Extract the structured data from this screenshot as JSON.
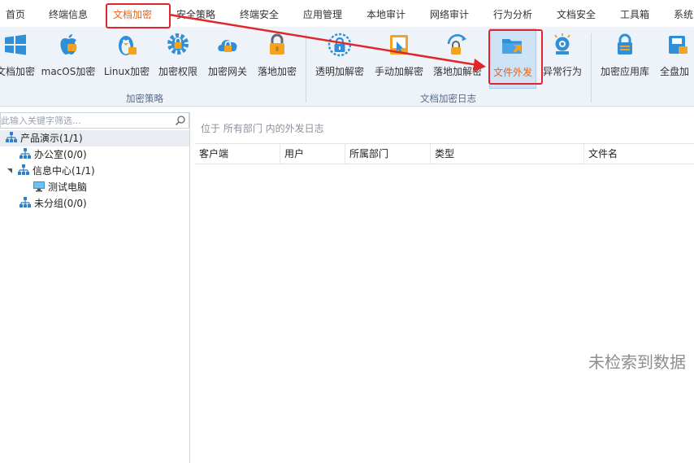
{
  "tabs": [
    "首页",
    "终端信息",
    "文档加密",
    "安全策略",
    "终端安全",
    "应用管理",
    "本地审计",
    "网络审计",
    "行为分析",
    "文档安全",
    "工具箱",
    "系统"
  ],
  "ribbon": {
    "groups": [
      {
        "label": "加密策略",
        "tools": [
          {
            "label": "文档加密",
            "icon": "windows-icon"
          },
          {
            "label": "macOS加密",
            "icon": "apple-icon"
          },
          {
            "label": "Linux加密",
            "icon": "linux-penguin-icon"
          },
          {
            "label": "加密权限",
            "icon": "gear-lock-icon"
          },
          {
            "label": "加密网关",
            "icon": "cloud-lock-icon"
          },
          {
            "label": "落地加密",
            "icon": "padlock-icon"
          }
        ]
      },
      {
        "label": "文档加密日志",
        "tools": [
          {
            "label": "透明加解密",
            "icon": "transparent-lock-icon"
          },
          {
            "label": "手动加解密",
            "icon": "manual-lock-icon"
          },
          {
            "label": "落地加解密",
            "icon": "refresh-lock-icon"
          },
          {
            "label": "文件外发",
            "icon": "folder-send-icon"
          },
          {
            "label": "异常行为",
            "icon": "alert-camera-icon"
          }
        ]
      },
      {
        "label": "",
        "tools": [
          {
            "label": "加密应用库",
            "icon": "app-lock-icon"
          },
          {
            "label": "全盘加",
            "icon": "disk-lock-icon"
          }
        ]
      }
    ]
  },
  "tree": {
    "filter_placeholder": "此输入关键字筛选...",
    "nodes": [
      {
        "label": "产品演示(1/1)",
        "type": "org"
      },
      {
        "label": "办公室(0/0)",
        "type": "org"
      },
      {
        "label": "信息中心(1/1)",
        "type": "org"
      },
      {
        "label": "测试电脑",
        "type": "computer"
      },
      {
        "label": "未分组(0/0)",
        "type": "org"
      }
    ]
  },
  "main": {
    "location": "位于 所有部门 内的外发日志",
    "columns": [
      "客户端",
      "用户",
      "所属部门",
      "类型",
      "文件名"
    ],
    "empty_text": "未检索到数据"
  },
  "colors": {
    "active_tab": "#e8641b",
    "annotation_red": "#e0262b",
    "ribbon_bg": "#eef3fa",
    "icon_blue": "#2f8fd8"
  }
}
